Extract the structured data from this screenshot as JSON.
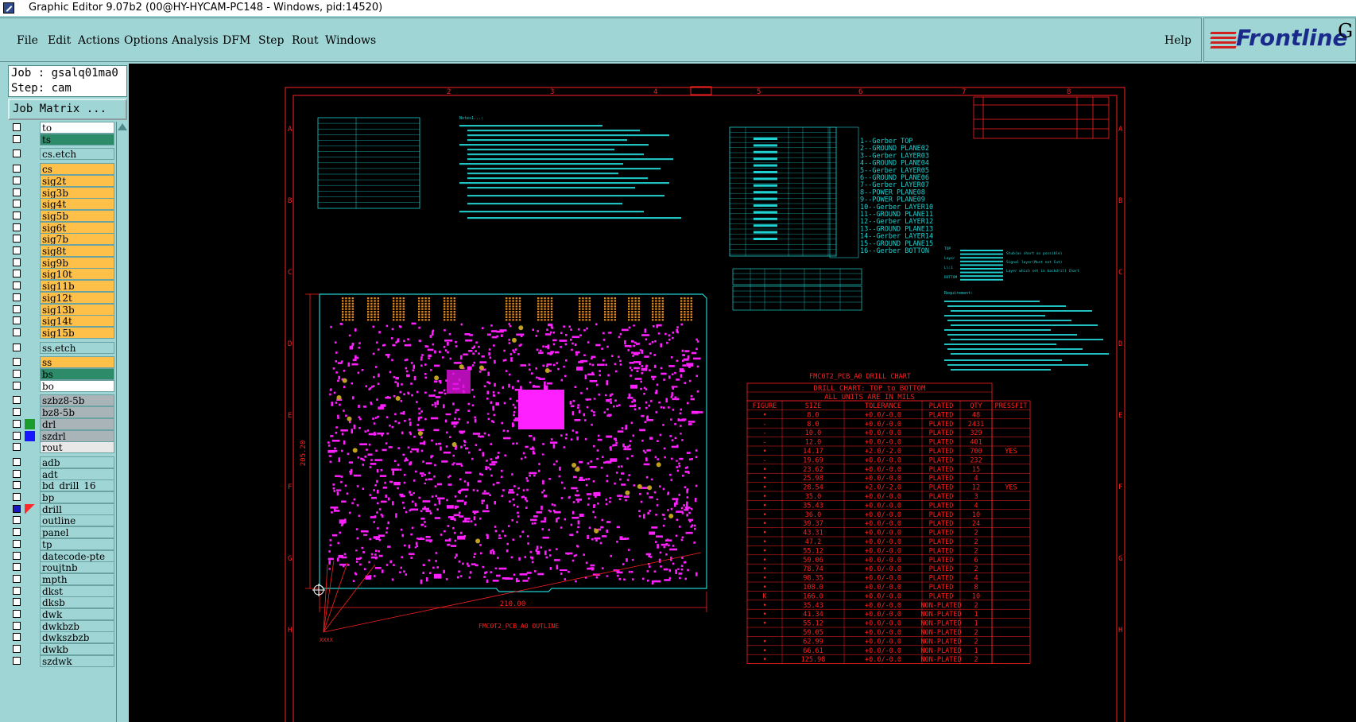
{
  "window": {
    "title": "Graphic Editor 9.07b2 (00@HY-HYCAM-PC148 - Windows, pid:14520)"
  },
  "menu": {
    "items": [
      {
        "label": "File"
      },
      {
        "label": "Edit"
      },
      {
        "label": "Actions"
      },
      {
        "label": "Options"
      },
      {
        "label": "Analysis"
      },
      {
        "label": "DFM"
      },
      {
        "label": "Step"
      },
      {
        "label": "Rout"
      },
      {
        "label": "Windows"
      }
    ],
    "help": "Help"
  },
  "brand": {
    "name": "Frontline",
    "extra": "G"
  },
  "job": {
    "job_line": "Job : gsalq01ma0",
    "step_line": "Step: cam",
    "matrix_button": "Job Matrix ..."
  },
  "layers": [
    {
      "name": "to",
      "color": "#ffffff"
    },
    {
      "name": "ts",
      "color": "#2e8b6a"
    },
    {
      "name": "cs.etch",
      "color": "#9fd5d5"
    },
    {
      "name": "cs",
      "color": "#ffc04a"
    },
    {
      "name": "sig2t",
      "color": "#ffc04a"
    },
    {
      "name": "sig3b",
      "color": "#ffc04a"
    },
    {
      "name": "sig4t",
      "color": "#ffc04a"
    },
    {
      "name": "sig5b",
      "color": "#ffc04a"
    },
    {
      "name": "sig6t",
      "color": "#ffc04a"
    },
    {
      "name": "sig7b",
      "color": "#ffc04a"
    },
    {
      "name": "sig8t",
      "color": "#ffc04a"
    },
    {
      "name": "sig9b",
      "color": "#ffc04a"
    },
    {
      "name": "sig10t",
      "color": "#ffc04a"
    },
    {
      "name": "sig11b",
      "color": "#ffc04a"
    },
    {
      "name": "sig12t",
      "color": "#ffc04a"
    },
    {
      "name": "sig13b",
      "color": "#ffc04a"
    },
    {
      "name": "sig14t",
      "color": "#ffc04a"
    },
    {
      "name": "sig15b",
      "color": "#ffc04a"
    },
    {
      "name": "ss.etch",
      "color": "#9fd5d5"
    },
    {
      "name": "ss",
      "color": "#ffc04a"
    },
    {
      "name": "bs",
      "color": "#2e8b6a"
    },
    {
      "name": "bo",
      "color": "#ffffff"
    },
    {
      "name": "szbz8-5b",
      "color": "#a8b4b8"
    },
    {
      "name": "bz8-5b",
      "color": "#a8b4b8"
    },
    {
      "name": "drl",
      "color": "#a8b4b8",
      "mark": "green"
    },
    {
      "name": "szdrl",
      "color": "#a8b4b8",
      "mark": "blue"
    },
    {
      "name": "rout",
      "color": "#e8e8e8"
    },
    {
      "name": "adb",
      "color": "#9fd5d5"
    },
    {
      "name": "adt",
      "color": "#9fd5d5"
    },
    {
      "name": "bd_drill_16",
      "color": "#9fd5d5"
    },
    {
      "name": "bp",
      "color": "#9fd5d5"
    },
    {
      "name": "drill",
      "color": "#9fd5d5",
      "mark": "cursor"
    },
    {
      "name": "outline",
      "color": "#9fd5d5"
    },
    {
      "name": "panel",
      "color": "#9fd5d5"
    },
    {
      "name": "tp",
      "color": "#9fd5d5"
    },
    {
      "name": "datecode-pte",
      "color": "#9fd5d5"
    },
    {
      "name": "roujtnb",
      "color": "#9fd5d5"
    },
    {
      "name": "mpth",
      "color": "#9fd5d5"
    },
    {
      "name": "dkst",
      "color": "#9fd5d5"
    },
    {
      "name": "dksb",
      "color": "#9fd5d5"
    },
    {
      "name": "dwk",
      "color": "#9fd5d5"
    },
    {
      "name": "dwkbzb",
      "color": "#9fd5d5"
    },
    {
      "name": "dwkszbzb",
      "color": "#9fd5d5"
    },
    {
      "name": "dwkb",
      "color": "#9fd5d5"
    },
    {
      "name": "szdwk",
      "color": "#9fd5d5"
    }
  ],
  "drawing": {
    "frame_cols": [
      "2",
      "3",
      "4",
      "5",
      "6",
      "7",
      "8"
    ],
    "frame_rows": [
      "A",
      "B",
      "C",
      "D",
      "E",
      "F",
      "G",
      "H"
    ],
    "layer_legend": [
      "1--Gerber TOP",
      "2--GROUND PLANE02",
      "3--Gerber LAYER03",
      "4--GROUND PLANE04",
      "5--Gerber LAYER05",
      "6--GROUND PLANE06",
      "7--Gerber LAYER07",
      "8--POWER PLANE08",
      "9--POWER PLANE09",
      "10--Gerber LAYER10",
      "11--GROUND PLANE11",
      "12--Gerber LAYER12",
      "13--GROUND PLANE13",
      "14--Gerber LAYER14",
      "15--GROUND PLANE15",
      "16--Gerber BOTTON"
    ],
    "drill_chart_title": "FMC0T2_PCB_A0 DRILL CHART",
    "drill_chart_sub1": "DRILL CHART: TOP to BOTTOM",
    "drill_chart_sub2": "ALL UNITS ARE IN MILS",
    "drill_headers": [
      "FIGURE",
      "SIZE",
      "TOLERANCE",
      "PLATED",
      "QTY",
      "PRESSFIT"
    ],
    "drill_rows": [
      [
        "•",
        "8.0",
        "+0.0/-0.0",
        "PLATED",
        "48",
        ""
      ],
      [
        "-",
        "8.0",
        "+0.0/-0.0",
        "PLATED",
        "2431",
        ""
      ],
      [
        "-",
        "10.0",
        "+0.0/-0.0",
        "PLATED",
        "329",
        ""
      ],
      [
        "-",
        "12.0",
        "+0.0/-0.0",
        "PLATED",
        "401",
        ""
      ],
      [
        "•",
        "14.17",
        "+2.0/-2.0",
        "PLATED",
        "700",
        "YES"
      ],
      [
        "-",
        "19.69",
        "+0.0/-0.0",
        "PLATED",
        "232",
        ""
      ],
      [
        "•",
        "23.62",
        "+0.0/-0.0",
        "PLATED",
        "15",
        ""
      ],
      [
        "•",
        "25.98",
        "+0.0/-0.0",
        "PLATED",
        "4",
        ""
      ],
      [
        "•",
        "28.54",
        "+2.0/-2.0",
        "PLATED",
        "12",
        "YES"
      ],
      [
        "•",
        "35.0",
        "+0.0/-0.0",
        "PLATED",
        "3",
        ""
      ],
      [
        "•",
        "35.43",
        "+0.0/-0.0",
        "PLATED",
        "4",
        ""
      ],
      [
        "•",
        "36.0",
        "+0.0/-0.0",
        "PLATED",
        "10",
        ""
      ],
      [
        "•",
        "39.37",
        "+0.0/-0.0",
        "PLATED",
        "24",
        ""
      ],
      [
        "•",
        "43.31",
        "+0.0/-0.0",
        "PLATED",
        "2",
        ""
      ],
      [
        "•",
        "47.2",
        "+0.0/-0.0",
        "PLATED",
        "2",
        ""
      ],
      [
        "•",
        "55.12",
        "+0.0/-0.0",
        "PLATED",
        "2",
        ""
      ],
      [
        "•",
        "59.06",
        "+0.0/-0.0",
        "PLATED",
        "6",
        ""
      ],
      [
        "•",
        "78.74",
        "+0.0/-0.0",
        "PLATED",
        "2",
        ""
      ],
      [
        "•",
        "98.35",
        "+0.0/-0.0",
        "PLATED",
        "4",
        ""
      ],
      [
        "•",
        "108.0",
        "+0.0/-0.0",
        "PLATED",
        "8",
        ""
      ],
      [
        "K",
        "166.0",
        "+0.0/-0.0",
        "PLATED",
        "10",
        ""
      ],
      [
        "•",
        "35.43",
        "+0.0/-0.0",
        "NON-PLATED",
        "2",
        ""
      ],
      [
        "•",
        "41.34",
        "+0.0/-0.0",
        "NON-PLATED",
        "1",
        ""
      ],
      [
        "•",
        "55.12",
        "+0.0/-0.0",
        "NON-PLATED",
        "1",
        ""
      ],
      [
        "",
        "59.05",
        "+0.0/-0.0",
        "NON-PLATED",
        "2",
        ""
      ],
      [
        "•",
        "62.99",
        "+0.0/-0.0",
        "NON-PLATED",
        "2",
        ""
      ],
      [
        "•",
        "66.61",
        "+0.0/-0.0",
        "NON-PLATED",
        "1",
        ""
      ],
      [
        "•",
        "125.98",
        "+0.0/-0.0",
        "NON-PLATED",
        "2",
        ""
      ]
    ],
    "outline_label": "FMC0T2_PCB_A0 OUTLINE",
    "dim_width": "210.00",
    "dim_height": "205.20",
    "origin_label": "XXXX",
    "notes_title": "Notes1...:",
    "requirement_title": "Requirement:",
    "stack_labels": [
      "TOP",
      "Layer",
      "L\\:1",
      "BOTTOM"
    ],
    "stack_notes": [
      "Stub(as short as possible)",
      "Signal layer(Must not Cut)",
      "Layer which set in backdrill Chart"
    ]
  }
}
